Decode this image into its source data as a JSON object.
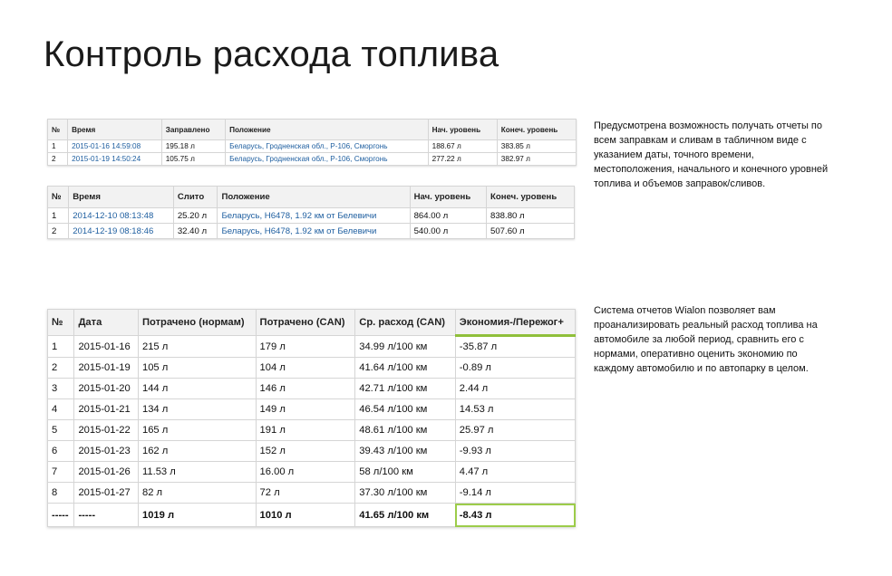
{
  "title": "Контроль расхода топлива",
  "refuels": {
    "headers": [
      "№",
      "Время",
      "Заправлено",
      "Положение",
      "Нач. уровень",
      "Конеч. уровень"
    ],
    "rows": [
      [
        "1",
        "2015-01-16 14:59:08",
        "195.18 л",
        "Беларусь, Гродненская обл., Р-106, Сморгонь",
        "188.67 л",
        "383.85 л"
      ],
      [
        "2",
        "2015-01-19 14:50:24",
        "105.75 л",
        "Беларусь, Гродненская обл., Р-106, Сморгонь",
        "277.22 л",
        "382.97 л"
      ]
    ]
  },
  "drains": {
    "headers": [
      "№",
      "Время",
      "Слито",
      "Положение",
      "Нач. уровень",
      "Конеч. уровень"
    ],
    "rows": [
      [
        "1",
        "2014-12-10 08:13:48",
        "25.20 л",
        "Беларусь, Н6478, 1.92 км от Белевичи",
        "864.00 л",
        "838.80 л"
      ],
      [
        "2",
        "2014-12-19 08:18:46",
        "32.40 л",
        "Беларусь, Н6478, 1.92 км от Белевичи",
        "540.00 л",
        "507.60 л"
      ]
    ]
  },
  "consumption": {
    "headers": [
      "№",
      "Дата",
      "Потрачено (нормам)",
      "Потрачено (CAN)",
      "Ср. расход (CAN)",
      "Экономия-/Пережог+"
    ],
    "rows": [
      [
        "1",
        "2015-01-16",
        "215 л",
        "179 л",
        "34.99 л/100 км",
        "-35.87 л"
      ],
      [
        "2",
        "2015-01-19",
        "105 л",
        "104 л",
        "41.64 л/100 км",
        "-0.89 л"
      ],
      [
        "3",
        "2015-01-20",
        "144 л",
        "146 л",
        "42.71 л/100 км",
        "2.44 л"
      ],
      [
        "4",
        "2015-01-21",
        "134 л",
        "149 л",
        "46.54 л/100 км",
        "14.53 л"
      ],
      [
        "5",
        "2015-01-22",
        "165 л",
        "191 л",
        "48.61 л/100 км",
        "25.97 л"
      ],
      [
        "6",
        "2015-01-23",
        "162 л",
        "152 л",
        "39.43 л/100 км",
        "-9.93 л"
      ],
      [
        "7",
        "2015-01-26",
        "11.53 л",
        "16.00 л",
        "58 л/100 км",
        "4.47 л"
      ],
      [
        "8",
        "2015-01-27",
        "82 л",
        "72 л",
        "37.30 л/100 км",
        "-9.14 л"
      ]
    ],
    "total": [
      "-----",
      "-----",
      "1019 л",
      "1010 л",
      "41.65 л/100 км",
      "-8.43 л"
    ]
  },
  "description_1": "Предусмотрена возможность получать отчеты по всем заправкам и сливам в табличном виде с указанием даты, точного времени, местоположения, начального и конечного уровней топлива и объемов заправок/сливов.",
  "description_2": "Система отчетов Wialon позволяет вам проанализировать реальный расход топлива на  автомобиле за любой период, сравнить его с нормами, оперативно оценить экономию по каждому автомобилю и по автопарку в целом.",
  "colors": {
    "link": "#1f5fa0",
    "highlight": "#9ccc4a",
    "header_bg": "#f2f2f2"
  }
}
